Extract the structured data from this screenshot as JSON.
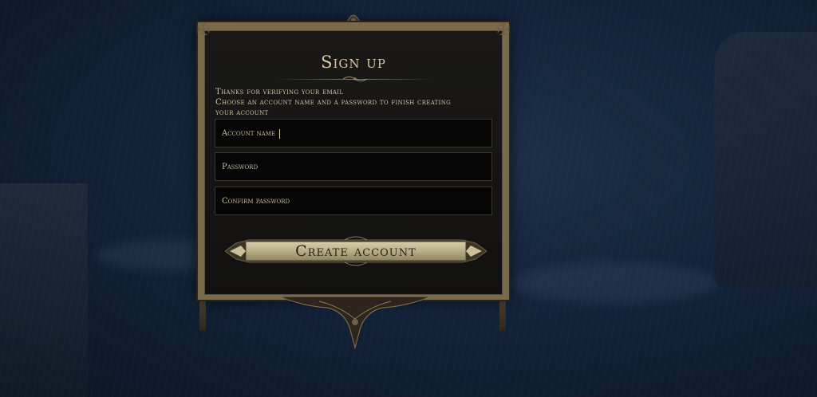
{
  "signup": {
    "title": "Sign up",
    "message_line1": "Thanks for verifying your email",
    "message_line2": "Choose an account name and a password to finish creating",
    "message_line3": "your account",
    "account_name_placeholder": "Account name",
    "password_placeholder": "Password",
    "confirm_password_placeholder": "Confirm password",
    "create_account_label": "Create account"
  },
  "colors": {
    "background": "#13233a",
    "panel": "#1a1917",
    "frame_gold": "#7a6a4c",
    "text_cream": "#d8c9a6",
    "button_gold": "#cbbf98"
  }
}
